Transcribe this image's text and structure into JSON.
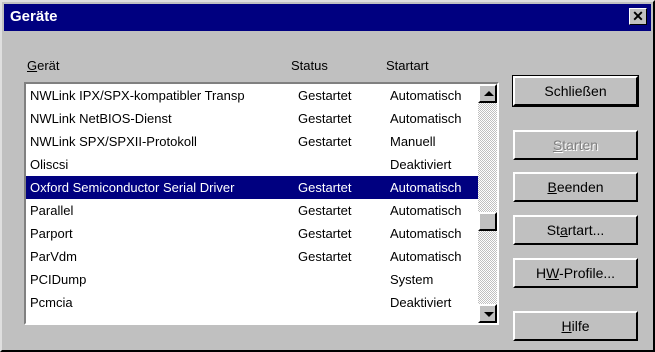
{
  "window": {
    "title": "Geräte"
  },
  "columns": {
    "device_prefix": "G",
    "device_rest": "erät",
    "status": "Status",
    "startart": "Startart"
  },
  "devices": [
    {
      "name": "NWLink IPX/SPX-kompatibler Transp",
      "status": "Gestartet",
      "startart": "Automatisch"
    },
    {
      "name": "NWLink NetBIOS-Dienst",
      "status": "Gestartet",
      "startart": "Automatisch"
    },
    {
      "name": "NWLink SPX/SPXII-Protokoll",
      "status": "Gestartet",
      "startart": "Manuell"
    },
    {
      "name": "Oliscsi",
      "status": "",
      "startart": "Deaktiviert"
    },
    {
      "name": "Oxford Semiconductor Serial Driver",
      "status": "Gestartet",
      "startart": "Automatisch"
    },
    {
      "name": "Parallel",
      "status": "Gestartet",
      "startart": "Automatisch"
    },
    {
      "name": "Parport",
      "status": "Gestartet",
      "startart": "Automatisch"
    },
    {
      "name": "ParVdm",
      "status": "Gestartet",
      "startart": "Automatisch"
    },
    {
      "name": "PCIDump",
      "status": "",
      "startart": "System"
    },
    {
      "name": "Pcmcia",
      "status": "",
      "startart": "Deaktiviert"
    }
  ],
  "buttons": {
    "close": "Schließen",
    "start_prefix": "S",
    "start_rest": "tarten",
    "stop_prefix": "B",
    "stop_rest": "eenden",
    "startart_prefix": "St",
    "startart_mn": "a",
    "startart_rest": "rtart...",
    "hw_prefix": "H",
    "hw_mn": "W",
    "hw_rest": "-Profile...",
    "help_mn": "H",
    "help_rest": "ilfe"
  },
  "colors": {
    "titlebar": "#000080",
    "selection": "#000080",
    "face": "#c0c0c0"
  }
}
